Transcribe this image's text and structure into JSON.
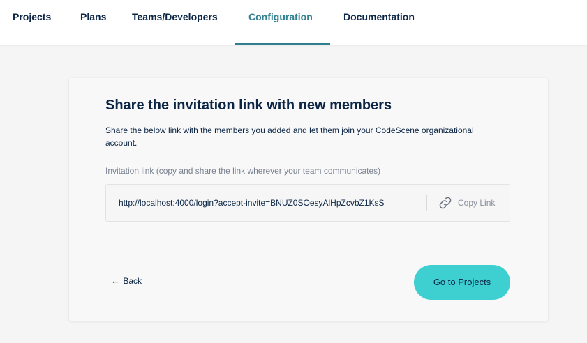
{
  "nav": {
    "items": [
      {
        "label": "Projects"
      },
      {
        "label": "Plans"
      },
      {
        "label": "Teams/Developers"
      },
      {
        "label": "Configuration"
      },
      {
        "label": "Documentation"
      }
    ],
    "active": "Configuration"
  },
  "card": {
    "title": "Share the invitation link with new members",
    "description": "Share the below link with the members you added and let them join your CodeScene organizational account.",
    "field_label": "Invitation link (copy and share the link wherever your team communicates)",
    "link_value": "http://localhost:4000/login?accept-invite=BNUZ0SOesyAlHpZcvbZ1KsS",
    "copy_label": "Copy Link",
    "copy_icon": "link-icon",
    "back_label": "Back",
    "back_icon": "arrow-left-icon",
    "primary_label": "Go to Projects"
  },
  "colors": {
    "accent": "#2f7f8f",
    "primary_button": "#3ecfd1",
    "text": "#0b2545",
    "muted": "#7a8290"
  }
}
